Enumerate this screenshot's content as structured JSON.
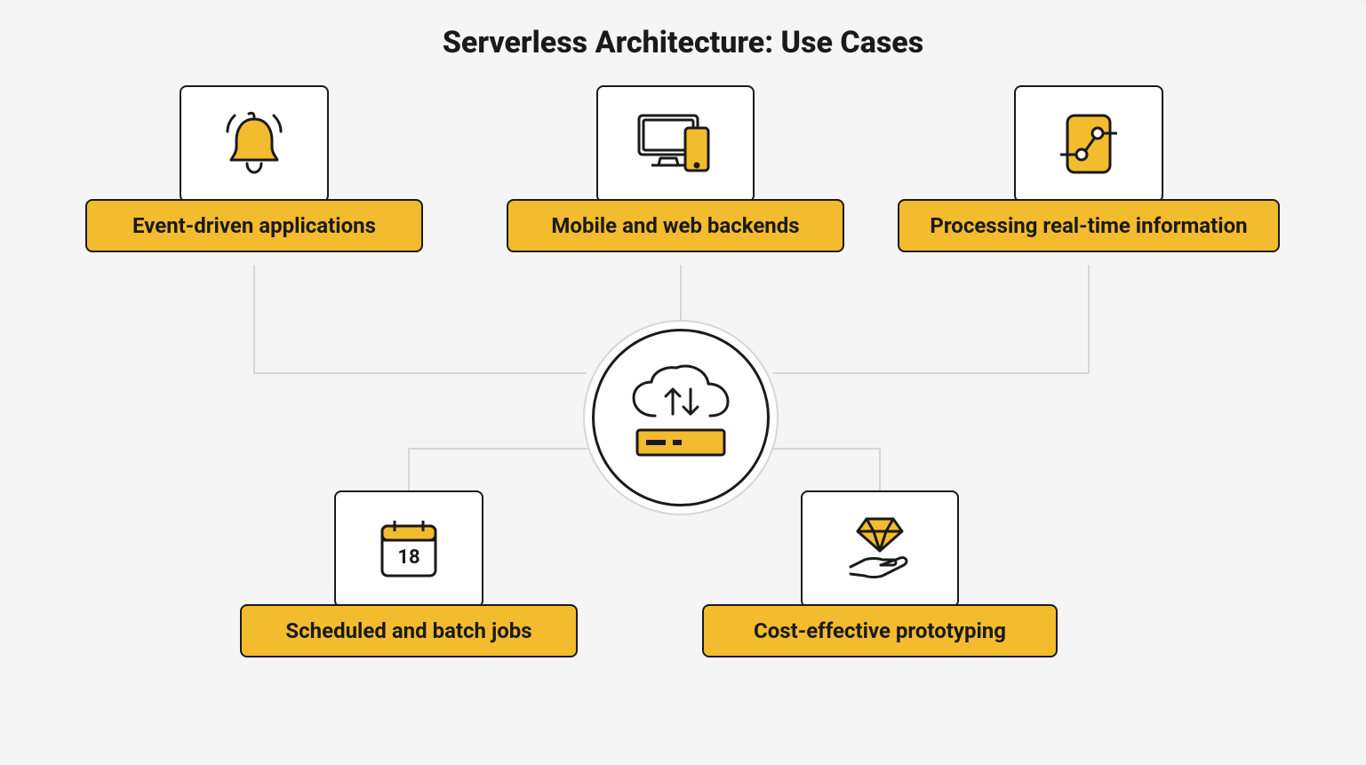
{
  "title": "Serverless Architecture: Use Cases",
  "usecases": {
    "event_driven": {
      "label": "Event-driven applications",
      "icon": "bell"
    },
    "mobile_web": {
      "label": "Mobile and web backends",
      "icon": "devices"
    },
    "realtime": {
      "label": "Processing real-time information",
      "icon": "data-chip"
    },
    "scheduled": {
      "label": "Scheduled and batch jobs",
      "icon": "calendar",
      "calendar_day": "18"
    },
    "prototyping": {
      "label": "Cost-effective prototyping",
      "icon": "diamond-hand"
    }
  },
  "hub": {
    "icon": "cloud-server"
  },
  "colors": {
    "accent": "#f3bb2e",
    "stroke": "#1a1a1a",
    "connector": "#d6d6d6",
    "bg": "#f5f5f5"
  }
}
